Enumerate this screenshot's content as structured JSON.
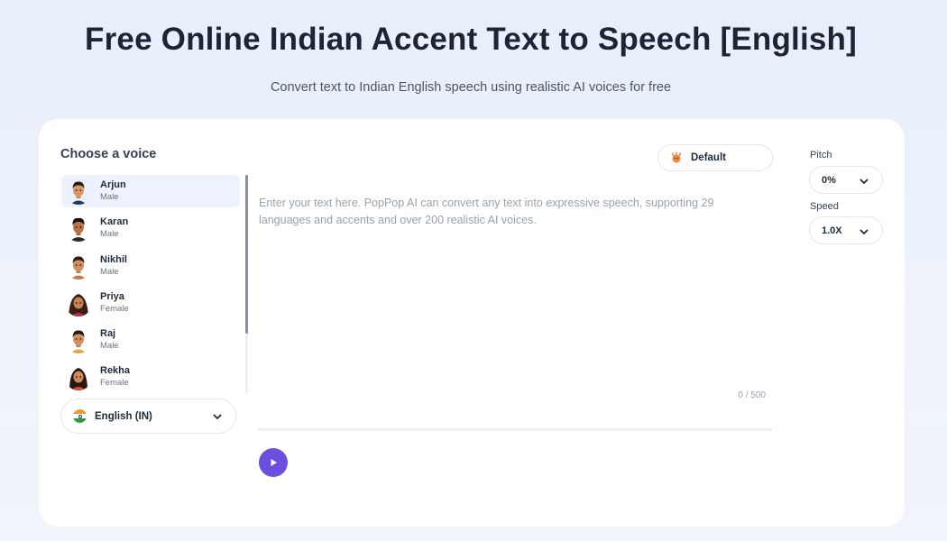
{
  "header": {
    "title": "Free Online Indian Accent Text to Speech [English]",
    "subtitle": "Convert text to Indian English speech using realistic AI voices for free"
  },
  "voice_panel": {
    "title": "Choose a voice",
    "voices": [
      {
        "name": "Arjun",
        "gender": "Male",
        "selected": true
      },
      {
        "name": "Karan",
        "gender": "Male",
        "selected": false
      },
      {
        "name": "Nikhil",
        "gender": "Male",
        "selected": false
      },
      {
        "name": "Priya",
        "gender": "Female",
        "selected": false
      },
      {
        "name": "Raj",
        "gender": "Male",
        "selected": false
      },
      {
        "name": "Rekha",
        "gender": "Female",
        "selected": false
      }
    ],
    "language": "English (IN)"
  },
  "editor": {
    "style_label": "Default",
    "placeholder": "Enter your text here. PopPop AI can convert any text into expressive speech, supporting 29 languages and accents and over 200 realistic AI voices.",
    "value": "",
    "counter": "0 / 500"
  },
  "controls": {
    "pitch_label": "Pitch",
    "pitch_value": "0%",
    "speed_label": "Speed",
    "speed_value": "1.0X"
  },
  "colors": {
    "accent": "#6d4fe0",
    "selected_bg": "#eef2fd"
  }
}
